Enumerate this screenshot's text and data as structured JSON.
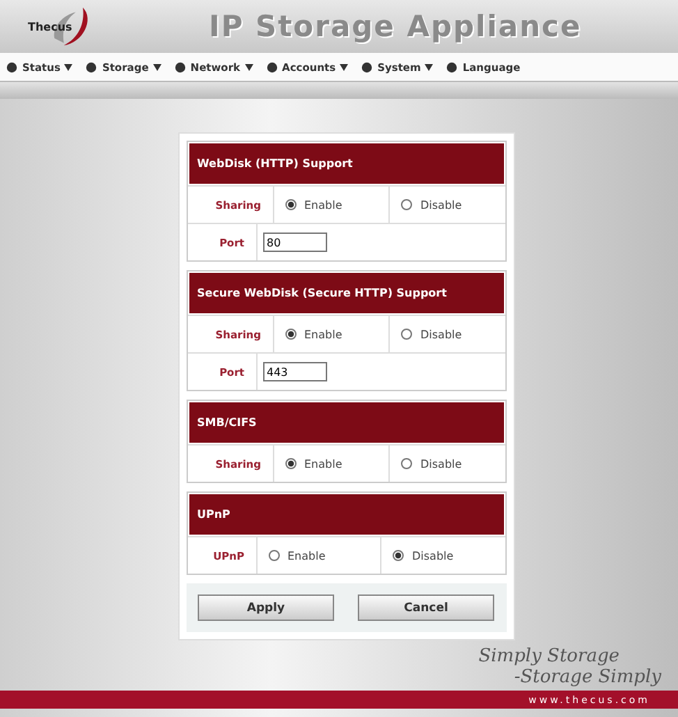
{
  "header": {
    "logo": "Thecus",
    "title": "IP Storage Appliance"
  },
  "menu": [
    {
      "label": "Status",
      "dropdown": true
    },
    {
      "label": "Storage",
      "dropdown": true
    },
    {
      "label": "Network",
      "dropdown": true
    },
    {
      "label": "Accounts",
      "dropdown": true
    },
    {
      "label": "System",
      "dropdown": true
    },
    {
      "label": "Language",
      "dropdown": false
    }
  ],
  "sections": [
    {
      "title": "WebDisk (HTTP) Support",
      "rows": [
        {
          "kind": "radio",
          "label": "Sharing",
          "options": [
            {
              "label": "Enable",
              "selected": true
            },
            {
              "label": "Disable",
              "selected": false
            }
          ]
        },
        {
          "kind": "field",
          "label": "Port",
          "value": "80"
        }
      ]
    },
    {
      "title": "Secure WebDisk (Secure HTTP) Support",
      "rows": [
        {
          "kind": "radio",
          "label": "Sharing",
          "options": [
            {
              "label": "Enable",
              "selected": true
            },
            {
              "label": "Disable",
              "selected": false
            }
          ]
        },
        {
          "kind": "field",
          "label": "Port",
          "value": "443"
        }
      ]
    },
    {
      "title": "SMB/CIFS",
      "rows": [
        {
          "kind": "radio",
          "label": "Sharing",
          "options": [
            {
              "label": "Enable",
              "selected": true
            },
            {
              "label": "Disable",
              "selected": false
            }
          ]
        }
      ]
    },
    {
      "title": "UPnP",
      "rows": [
        {
          "kind": "radio",
          "label": "UPnP",
          "options": [
            {
              "label": "Enable",
              "selected": false
            },
            {
              "label": "Disable",
              "selected": true
            }
          ]
        }
      ]
    }
  ],
  "buttons": [
    "Apply",
    "Cancel"
  ],
  "slogan": [
    "Simply Storage",
    "-Storage Simply"
  ],
  "footer": "www.thecus.com"
}
